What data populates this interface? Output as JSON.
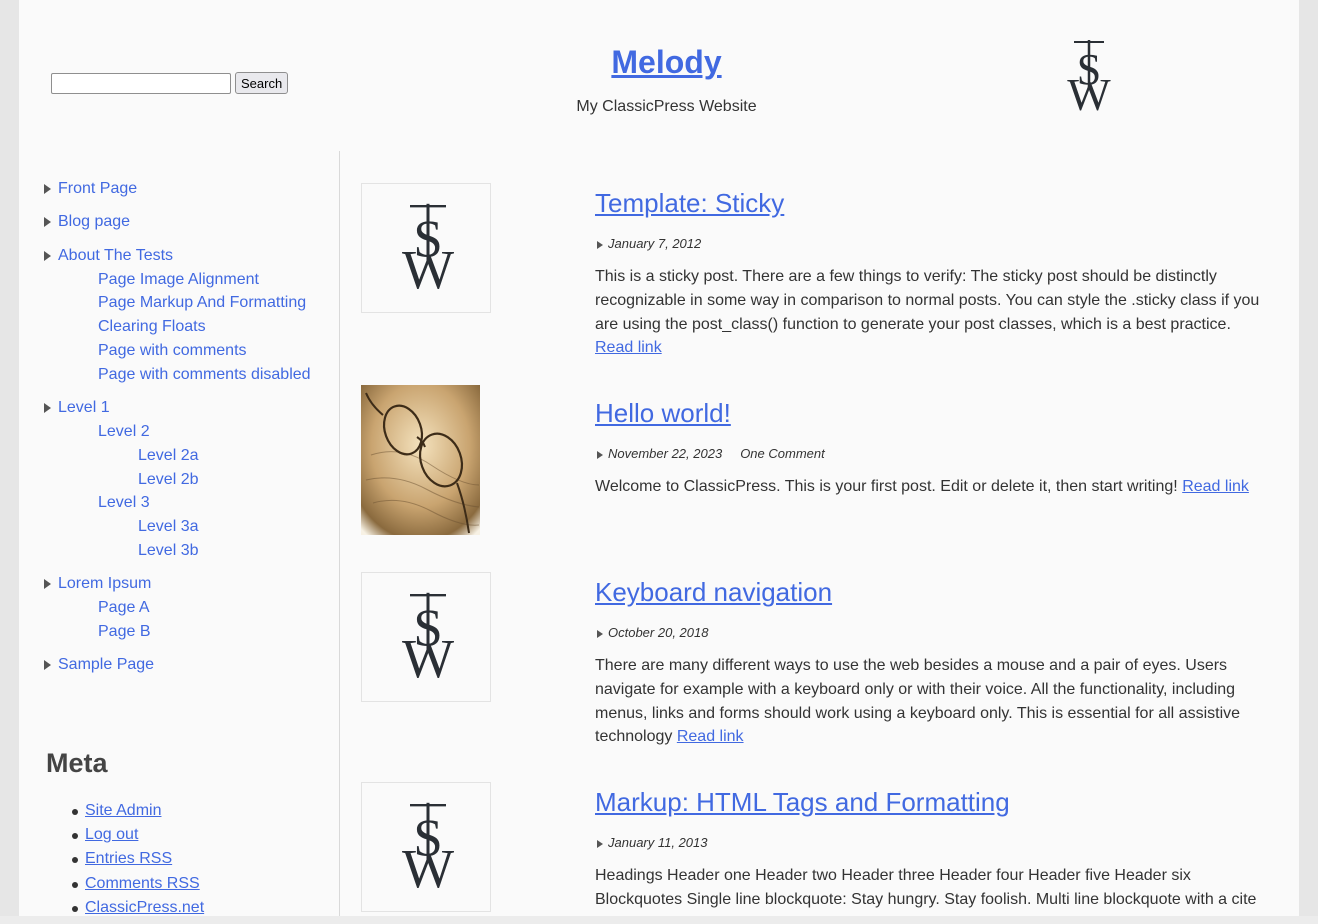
{
  "search": {
    "placeholder": "",
    "value": "",
    "button_label": "Search"
  },
  "site": {
    "title": "Melody",
    "description": "My ClassicPress Website"
  },
  "nav": [
    {
      "label": "Front Page",
      "level": 0
    },
    {
      "label": "Blog page",
      "level": 0
    },
    {
      "label": "About The Tests",
      "level": 0
    },
    {
      "label": "Page Image Alignment",
      "level": 1
    },
    {
      "label": "Page Markup And Formatting",
      "level": 1
    },
    {
      "label": "Clearing Floats",
      "level": 1
    },
    {
      "label": "Page with comments",
      "level": 1
    },
    {
      "label": "Page with comments disabled",
      "level": 1
    },
    {
      "label": "Level 1",
      "level": 0
    },
    {
      "label": "Level 2",
      "level": 1
    },
    {
      "label": "Level 2a",
      "level": 2
    },
    {
      "label": "Level 2b",
      "level": 2
    },
    {
      "label": "Level 3",
      "level": 1
    },
    {
      "label": "Level 3a",
      "level": 2
    },
    {
      "label": "Level 3b",
      "level": 2
    },
    {
      "label": "Lorem Ipsum",
      "level": 0
    },
    {
      "label": "Page A",
      "level": 1
    },
    {
      "label": "Page B",
      "level": 1
    },
    {
      "label": "Sample Page",
      "level": 0
    }
  ],
  "meta": {
    "title": "Meta",
    "links": [
      "Site Admin",
      "Log out",
      "Entries RSS",
      "Comments RSS",
      "ClassicPress.net"
    ]
  },
  "logo": {
    "glyph_top": "S",
    "glyph_bottom": "W",
    "icon": "tsw-logo-icon"
  },
  "posts": [
    {
      "title": "Template: Sticky",
      "date": "January 7, 2012",
      "comments": "",
      "thumbnail": "logo",
      "excerpt": "This is a sticky post. There are a few things to verify: The sticky post should be distinctly recognizable in some way in comparison to normal posts. You can style the .sticky class if you are using the post_class() function to generate your post classes, which is a best practice.",
      "read_link": "Read link"
    },
    {
      "title": "Hello world!",
      "date": "November 22, 2023",
      "comments": "One Comment",
      "thumbnail": "glasses-photo",
      "excerpt": "Welcome to ClassicPress. This is your first post. Edit or delete it, then start writing!",
      "read_link": "Read link"
    },
    {
      "title": "Keyboard navigation",
      "date": "October 20, 2018",
      "comments": "",
      "thumbnail": "logo",
      "excerpt": "There are many different ways to use the web besides a mouse and a pair of eyes. Users navigate for example with a keyboard only or with their voice. All the functionality, including menus, links and forms should work using a keyboard only. This is essential for all assistive technology",
      "read_link": "Read link"
    },
    {
      "title": "Markup: HTML Tags and Formatting",
      "date": "January 11, 2013",
      "comments": "",
      "thumbnail": "logo",
      "excerpt": "Headings Header one Header two Header three Header four Header five Header six Blockquotes Single line blockquote: Stay hungry. Stay foolish. Multi line blockquote with a cite reference: The HTML <blockquote> Element (or HTML Block Quotation Element) indicates",
      "read_link": ""
    }
  ],
  "colors": {
    "link": "#4169e1",
    "text": "#333333",
    "page_bg": "#fafafa",
    "outer_bg": "#e6e6e6"
  }
}
